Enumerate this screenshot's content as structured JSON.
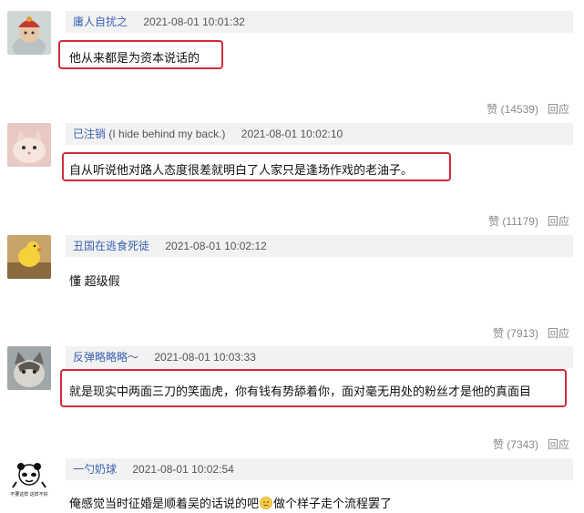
{
  "comments": [
    {
      "user": "庸人自扰之",
      "time": "2021-08-01 10:01:32",
      "text": "他从来都是为资本说话的",
      "likes": "赞 (14539)",
      "reply": "回应"
    },
    {
      "user": "已注销",
      "user_note": "(I hide behind my back.)",
      "time": "2021-08-01 10:02:10",
      "text": "自从听说他对路人态度很差就明白了人家只是逢场作戏的老油子。",
      "likes": "赞 (11179)",
      "reply": "回应"
    },
    {
      "user": "丑国在逃食死徒",
      "time": "2021-08-01 10:02:12",
      "text": "懂 超级假",
      "likes": "赞 (7913)",
      "reply": "回应"
    },
    {
      "user": "反弹略略略～",
      "time": "2021-08-01 10:03:33",
      "text": "就是现实中两面三刀的笑面虎，你有钱有势舔着你，面对毫无用处的粉丝才是他的真面目",
      "likes": "赞 (7343)",
      "reply": "回应"
    },
    {
      "user": "一勺奶球",
      "time": "2021-08-01 10:02:54",
      "text_a": "俺感觉当时征婚是顺着吴的话说的吧",
      "text_b": "做个样子走个流程罢了",
      "avatar_caption": "不要这样 这样不好"
    }
  ],
  "colors": {
    "highlight": "#d32a3c",
    "username": "#3b63b0",
    "header_bg": "#f2f2f2"
  }
}
